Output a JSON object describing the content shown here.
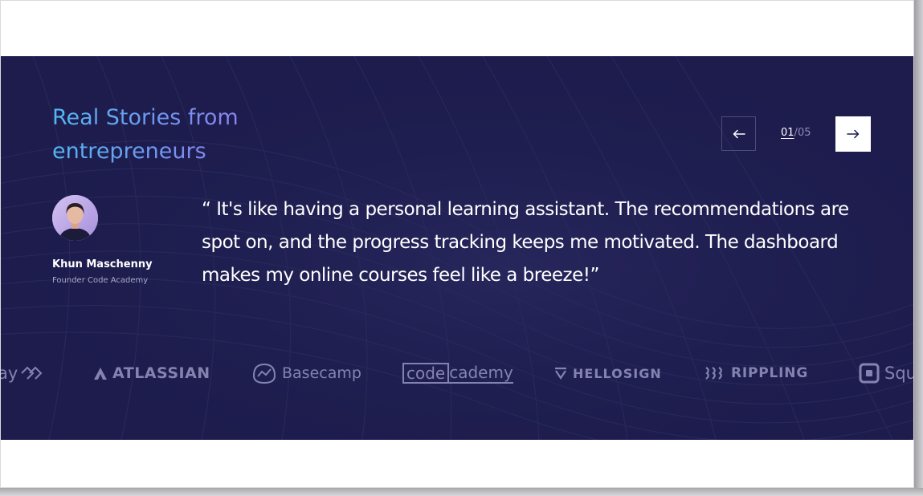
{
  "section": {
    "headline_line1": "Real Stories from",
    "headline_line2": "entrepreneurs"
  },
  "pagination": {
    "current": "01",
    "separator": "/",
    "total": "05",
    "prev_icon": "arrow-left-icon",
    "next_icon": "arrow-right-icon"
  },
  "testimonial": {
    "author_name": "Khun Maschenny",
    "author_role": "Founder Code Academy",
    "quote": "“ It's like having a personal learning assistant. The recommendations are spot on, and the progress tracking keeps me motivated. The dashboard makes my online courses feel like a breeze!”"
  },
  "logos": [
    {
      "name": "ay",
      "icon": "zigzag-icon"
    },
    {
      "name": "ATLASSIAN",
      "icon": "atlassian-triangle-icon"
    },
    {
      "name": "Basecamp",
      "icon": "basecamp-chart-icon"
    },
    {
      "name_boxed": "code",
      "name_rest": "cademy"
    },
    {
      "name": "HELLOSIGN",
      "icon": "hellosign-check-icon"
    },
    {
      "name": "RIPPLING",
      "icon": "rippling-waves-icon"
    },
    {
      "name": "Squ",
      "icon": "square-box-icon"
    }
  ],
  "colors": {
    "banner_background": "#1d1c4d",
    "headline_gradient_start": "#52b8f2",
    "headline_gradient_end": "#a575e8",
    "logo_gray": "#8483b0"
  }
}
